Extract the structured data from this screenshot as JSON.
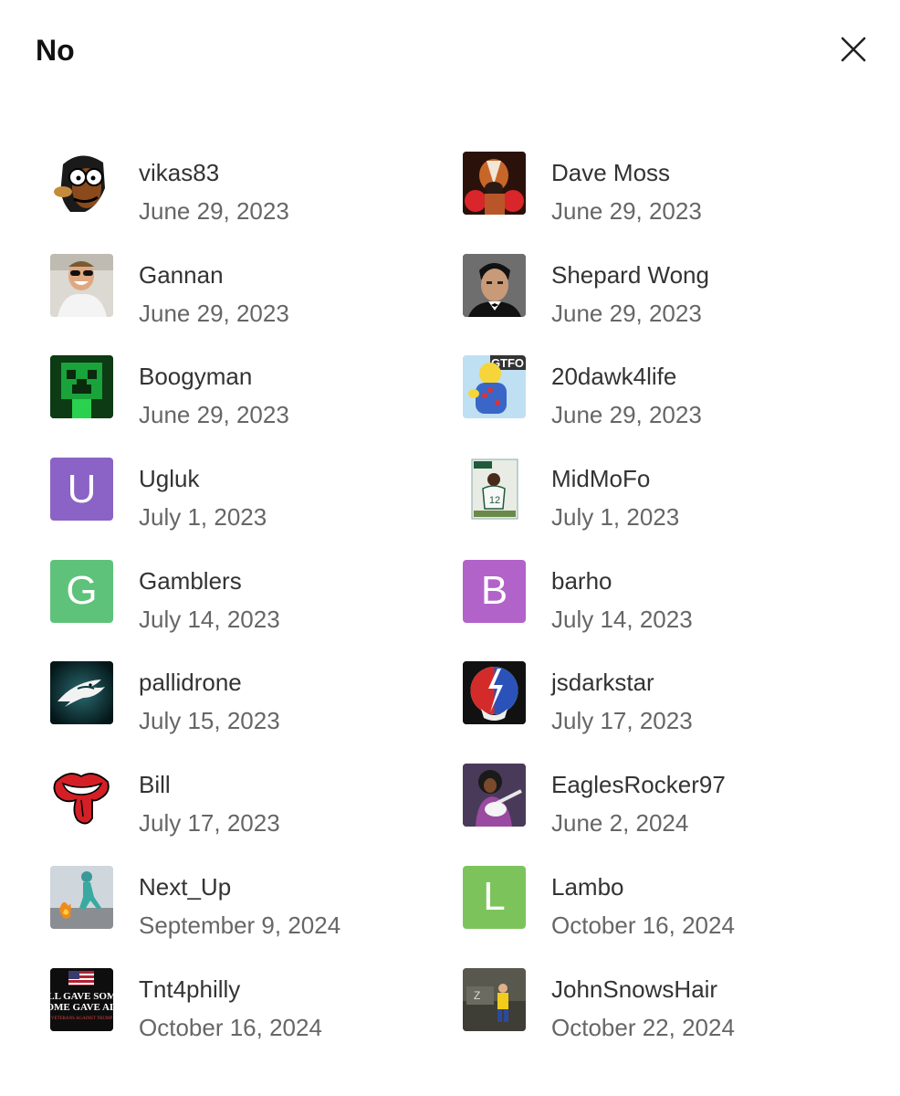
{
  "dialog": {
    "title": "No",
    "close_icon": "close-icon"
  },
  "voters": [
    {
      "name": "vikas83",
      "date": "June 29, 2023",
      "avatar": {
        "type": "image",
        "icon": "cartoon-face-avatar",
        "bg": "#ffffff"
      }
    },
    {
      "name": "Dave Moss",
      "date": "June 29, 2023",
      "avatar": {
        "type": "image",
        "icon": "boxer-dog-avatar",
        "bg": "#3a1a10"
      }
    },
    {
      "name": "Gannan",
      "date": "June 29, 2023",
      "avatar": {
        "type": "image",
        "icon": "laughing-man-sunglasses-avatar",
        "bg": "#d9d6d0"
      }
    },
    {
      "name": "Shepard Wong",
      "date": "June 29, 2023",
      "avatar": {
        "type": "image",
        "icon": "man-portrait-avatar",
        "bg": "#4a4a4a"
      }
    },
    {
      "name": "Boogyman",
      "date": "June 29, 2023",
      "avatar": {
        "type": "image",
        "icon": "creeper-avatar",
        "bg": "#0e3a12"
      }
    },
    {
      "name": "20dawk4life",
      "date": "June 29, 2023",
      "avatar": {
        "type": "image",
        "icon": "gtfo-cartoon-avatar",
        "bg": "#bfe0f2"
      }
    },
    {
      "name": "Ugluk",
      "date": "July 1, 2023",
      "avatar": {
        "type": "letter",
        "letter": "U",
        "bg": "#8b62c5"
      }
    },
    {
      "name": "MidMoFo",
      "date": "July 1, 2023",
      "avatar": {
        "type": "image",
        "icon": "football-card-avatar",
        "bg": "#f2f2f2"
      }
    },
    {
      "name": "Gamblers",
      "date": "July 14, 2023",
      "avatar": {
        "type": "letter",
        "letter": "G",
        "bg": "#5fc27a"
      }
    },
    {
      "name": "barho",
      "date": "July 14, 2023",
      "avatar": {
        "type": "letter",
        "letter": "B",
        "bg": "#b263c9"
      }
    },
    {
      "name": "pallidrone",
      "date": "July 15, 2023",
      "avatar": {
        "type": "image",
        "icon": "eagle-logo-avatar",
        "bg": "#07242a"
      }
    },
    {
      "name": "jsdarkstar",
      "date": "July 17, 2023",
      "avatar": {
        "type": "image",
        "icon": "steal-your-face-avatar",
        "bg": "#111111"
      }
    },
    {
      "name": "Bill",
      "date": "July 17, 2023",
      "avatar": {
        "type": "image",
        "icon": "tongue-logo-avatar",
        "bg": "#ffffff"
      }
    },
    {
      "name": "EaglesRocker97",
      "date": "June 2, 2024",
      "avatar": {
        "type": "image",
        "icon": "guitarist-avatar",
        "bg": "#5a4a6a"
      }
    },
    {
      "name": "Next_Up",
      "date": "September 9, 2024",
      "avatar": {
        "type": "image",
        "icon": "running-man-avatar",
        "bg": "#cfd6dc"
      }
    },
    {
      "name": "Lambo",
      "date": "October 16, 2024",
      "avatar": {
        "type": "letter",
        "letter": "L",
        "bg": "#7cc35c"
      }
    },
    {
      "name": "Tnt4philly",
      "date": "October 16, 2024",
      "avatar": {
        "type": "image",
        "icon": "flag-text-avatar",
        "bg": "#111111"
      }
    },
    {
      "name": "JohnSnowsHair",
      "date": "October 22, 2024",
      "avatar": {
        "type": "image",
        "icon": "child-on-tank-avatar",
        "bg": "#4a4a44"
      }
    }
  ]
}
